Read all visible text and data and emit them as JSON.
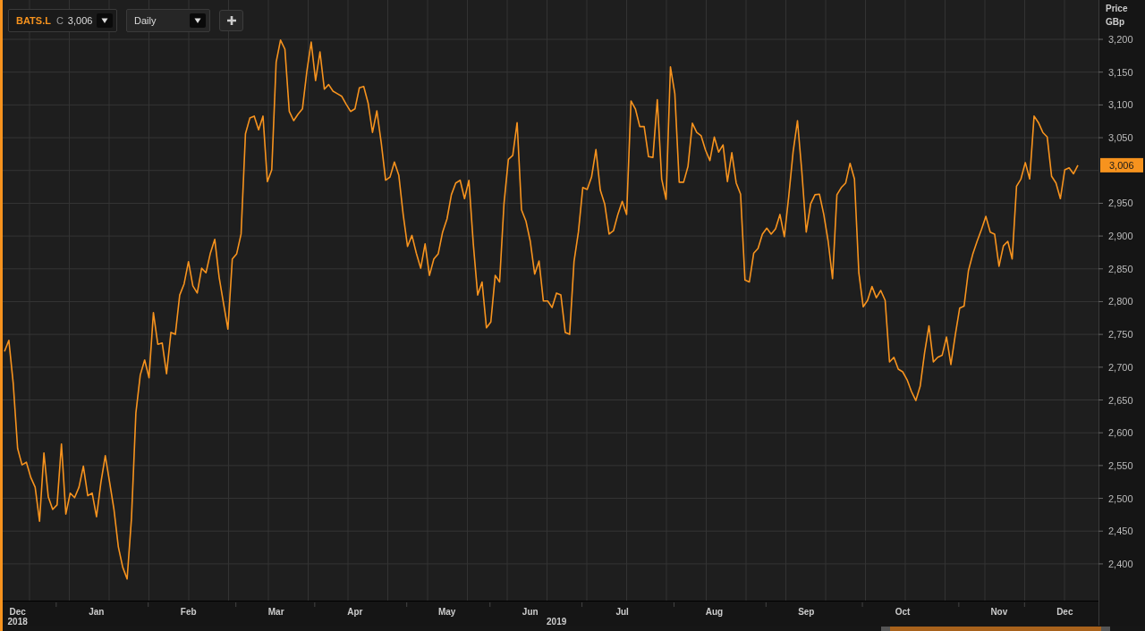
{
  "toolbar": {
    "instrument": {
      "symbol": "BATS.L",
      "field": "C",
      "value": "3,006"
    },
    "interval": {
      "value": "Daily"
    }
  },
  "chart": {
    "y_axis_title": [
      "Price",
      "GBp"
    ],
    "last_price": "3,006",
    "year_labels": [
      "2018",
      "2019"
    ],
    "chart_data": {
      "type": "line",
      "grid": true,
      "categories": [
        null,
        null,
        null,
        "Dec",
        null,
        null,
        null,
        null,
        null,
        null,
        null,
        null,
        null,
        null,
        null,
        null,
        null,
        null,
        null,
        null,
        null,
        "Jan",
        null,
        null,
        null,
        null,
        null,
        null,
        null,
        null,
        null,
        null,
        null,
        null,
        null,
        null,
        null,
        null,
        null,
        null,
        null,
        null,
        "Feb",
        null,
        null,
        null,
        null,
        null,
        null,
        null,
        null,
        null,
        null,
        null,
        null,
        null,
        null,
        null,
        null,
        null,
        null,
        null,
        "Mar",
        null,
        null,
        null,
        null,
        null,
        null,
        null,
        null,
        null,
        null,
        null,
        null,
        null,
        null,
        null,
        null,
        null,
        "Apr",
        null,
        null,
        null,
        null,
        null,
        null,
        null,
        null,
        null,
        null,
        null,
        null,
        null,
        null,
        null,
        null,
        null,
        null,
        null,
        null,
        "May",
        null,
        null,
        null,
        null,
        null,
        null,
        null,
        null,
        null,
        null,
        null,
        null,
        null,
        null,
        null,
        null,
        null,
        null,
        "Jun",
        null,
        null,
        null,
        null,
        null,
        null,
        null,
        null,
        null,
        null,
        null,
        null,
        null,
        null,
        null,
        null,
        null,
        null,
        null,
        null,
        "Jul",
        null,
        null,
        null,
        null,
        null,
        null,
        null,
        null,
        null,
        null,
        null,
        null,
        null,
        null,
        null,
        null,
        null,
        null,
        null,
        null,
        "Aug",
        null,
        null,
        null,
        null,
        null,
        null,
        null,
        null,
        null,
        null,
        null,
        null,
        null,
        null,
        null,
        null,
        null,
        null,
        null,
        null,
        "Sep",
        null,
        null,
        null,
        null,
        null,
        null,
        null,
        null,
        null,
        null,
        null,
        null,
        null,
        null,
        null,
        null,
        null,
        null,
        null,
        null,
        null,
        "Oct",
        null,
        null,
        null,
        null,
        null,
        null,
        null,
        null,
        null,
        null,
        null,
        null,
        null,
        null,
        null,
        null,
        null,
        null,
        null,
        null,
        null,
        "Nov",
        null,
        null,
        null,
        null,
        null,
        null,
        null,
        null,
        null,
        null,
        null,
        null,
        null,
        null,
        "Dec",
        null,
        null,
        null
      ],
      "series": [
        {
          "color": "#f7931e",
          "values": [
            2724,
            2741,
            2675,
            2576,
            2551,
            2555,
            2532,
            2517,
            2465,
            2569,
            2502,
            2483,
            2490,
            2583,
            2476,
            2508,
            2501,
            2517,
            2549,
            2504,
            2508,
            2472,
            2524,
            2565,
            2524,
            2483,
            2426,
            2395,
            2377,
            2470,
            2630,
            2688,
            2711,
            2684,
            2783,
            2735,
            2737,
            2690,
            2753,
            2750,
            2810,
            2827,
            2861,
            2824,
            2813,
            2851,
            2844,
            2874,
            2895,
            2837,
            2797,
            2758,
            2865,
            2873,
            2903,
            3056,
            3080,
            3083,
            3062,
            3083,
            2983,
            3001,
            3165,
            3199,
            3185,
            3090,
            3076,
            3086,
            3094,
            3151,
            3196,
            3137,
            3181,
            3124,
            3131,
            3121,
            3117,
            3113,
            3101,
            3090,
            3094,
            3126,
            3128,
            3103,
            3058,
            3091,
            3042,
            2985,
            2990,
            3013,
            2993,
            2933,
            2884,
            2901,
            2874,
            2851,
            2888,
            2840,
            2865,
            2873,
            2906,
            2926,
            2963,
            2981,
            2985,
            2957,
            2985,
            2888,
            2810,
            2830,
            2760,
            2769,
            2840,
            2830,
            2949,
            3017,
            3023,
            3073,
            2940,
            2923,
            2892,
            2842,
            2862,
            2801,
            2801,
            2791,
            2813,
            2810,
            2753,
            2750,
            2861,
            2906,
            2974,
            2971,
            2990,
            3032,
            2970,
            2949,
            2903,
            2908,
            2933,
            2953,
            2933,
            3106,
            3094,
            3067,
            3067,
            3021,
            3020,
            3108,
            2987,
            2956,
            3158,
            3117,
            2982,
            2982,
            3006,
            3072,
            3058,
            3053,
            3031,
            3015,
            3051,
            3028,
            3039,
            2983,
            3027,
            2981,
            2964,
            2833,
            2830,
            2874,
            2881,
            2903,
            2912,
            2903,
            2911,
            2933,
            2899,
            2960,
            3028,
            3076,
            2998,
            2906,
            2949,
            2963,
            2964,
            2933,
            2892,
            2835,
            2963,
            2974,
            2981,
            3011,
            2987,
            2844,
            2792,
            2802,
            2823,
            2806,
            2817,
            2802,
            2708,
            2715,
            2697,
            2693,
            2681,
            2663,
            2649,
            2671,
            2722,
            2763,
            2708,
            2715,
            2718,
            2746,
            2704,
            2749,
            2790,
            2793,
            2847,
            2872,
            2892,
            2910,
            2930,
            2906,
            2903,
            2854,
            2885,
            2892,
            2865,
            2976,
            2987,
            3012,
            2987,
            3083,
            3073,
            3058,
            3051,
            2991,
            2981,
            2957,
            3001,
            3004,
            2995,
            3008
          ]
        }
      ],
      "ylim": [
        2344,
        3260
      ],
      "yticks": [
        {
          "value": 2400,
          "label": "2,400"
        },
        {
          "value": 2450,
          "label": "2,450"
        },
        {
          "value": 2500,
          "label": "2,500"
        },
        {
          "value": 2550,
          "label": "2,550"
        },
        {
          "value": 2600,
          "label": "2,600"
        },
        {
          "value": 2650,
          "label": "2,650"
        },
        {
          "value": 2700,
          "label": "2,700"
        },
        {
          "value": 2750,
          "label": "2,750"
        },
        {
          "value": 2800,
          "label": "2,800"
        },
        {
          "value": 2850,
          "label": "2,850"
        },
        {
          "value": 2900,
          "label": "2,900"
        },
        {
          "value": 2950,
          "label": "2,950"
        },
        {
          "value": 3050,
          "label": "3,050"
        },
        {
          "value": 3100,
          "label": "3,100"
        },
        {
          "value": 3150,
          "label": "3,150"
        },
        {
          "value": 3200,
          "label": "3,200"
        }
      ]
    }
  }
}
